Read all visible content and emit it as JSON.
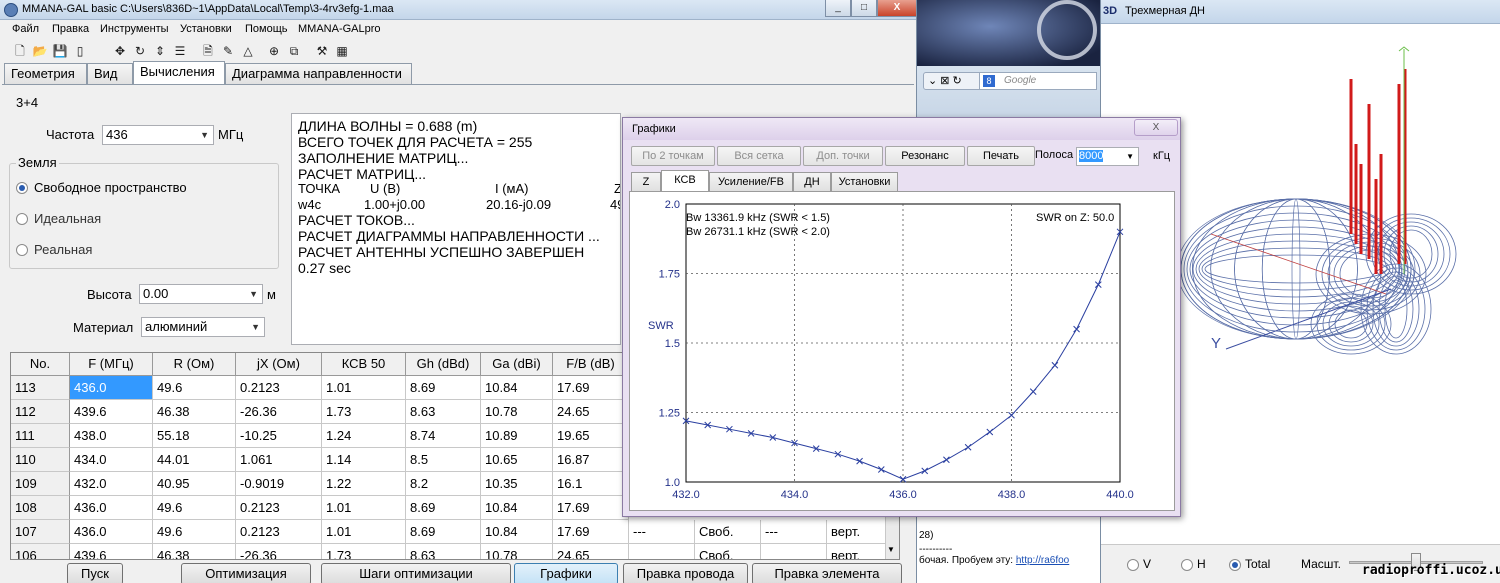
{
  "main_window": {
    "title": "MMANA-GAL basic C:\\Users\\836D~1\\AppData\\Local\\Temp\\3-4rv3efg-1.maa",
    "caption_buttons": [
      "_",
      "□",
      "X"
    ],
    "menu": [
      "Файл",
      "Правка",
      "Инструменты",
      "Установки",
      "Помощь",
      "MMANA-GALpro"
    ],
    "tabs": [
      "Геометрия",
      "Вид",
      "Вычисления",
      "Диаграмма направленности"
    ],
    "antenna_name": "3+4",
    "frequency": {
      "label": "Частота",
      "value": "436",
      "unit": "МГц"
    },
    "ground": {
      "label": "Земля",
      "options": [
        "Свободное пространство",
        "Идеальная",
        "Реальная"
      ],
      "selected": "Свободное пространство"
    },
    "height": {
      "label": "Высота",
      "value": "0.00",
      "unit": "м"
    },
    "material": {
      "label": "Материал",
      "value": "алюминий"
    },
    "log": [
      "ДЛИНА ВОЛНЫ = 0.688 (m)",
      "ВСЕГО ТОЧЕК ДЛЯ РАСЧЕТА = 255",
      "ЗАПОЛНЕНИЕ МАТРИЦ...",
      "РАСЧЕТ МАТРИЦ...",
      "РАСЧЕТ ТОКОВ...",
      "РАСЧЕТ ДИАГРАММЫ НАПРАВЛЕННОСТИ ...",
      "РАСЧЕТ АНТЕННЫ УСПЕШНО ЗАВЕРШЕН",
      "0.27 sec"
    ],
    "log_point_header": [
      "ТОЧКА",
      "U (В)",
      "I (мА)",
      "Z"
    ],
    "log_point_row": [
      "w4c",
      "1.00+j0.00",
      "20.16-j0.09",
      "49"
    ],
    "table": {
      "columns": [
        "No.",
        "F (МГц)",
        "R (Ом)",
        "jX (Ом)",
        "КСВ 50",
        "Gh (dBd)",
        "Ga (dBi)",
        "F/B (dB)"
      ],
      "rows": [
        [
          "113",
          "436.0",
          "49.6",
          "0.2123",
          "1.01",
          "8.69",
          "10.84",
          "17.69"
        ],
        [
          "112",
          "439.6",
          "46.38",
          "-26.36",
          "1.73",
          "8.63",
          "10.78",
          "24.65"
        ],
        [
          "111",
          "438.0",
          "55.18",
          "-10.25",
          "1.24",
          "8.74",
          "10.89",
          "19.65"
        ],
        [
          "110",
          "434.0",
          "44.01",
          "1.061",
          "1.14",
          "8.5",
          "10.65",
          "16.87"
        ],
        [
          "109",
          "432.0",
          "40.95",
          "-0.9019",
          "1.22",
          "8.2",
          "10.35",
          "16.1"
        ],
        [
          "108",
          "436.0",
          "49.6",
          "0.2123",
          "1.01",
          "8.69",
          "10.84",
          "17.69"
        ],
        [
          "107",
          "436.0",
          "49.6",
          "0.2123",
          "1.01",
          "8.69",
          "10.84",
          "17.69"
        ],
        [
          "106",
          "439.6",
          "46.38",
          "-26.36",
          "1.73",
          "8.63",
          "10.78",
          "24.65"
        ]
      ],
      "row107_extra": [
        "---",
        "Своб.",
        "---",
        "верт."
      ],
      "row106_extra": [
        "",
        "Своб.",
        "",
        "верт."
      ]
    },
    "bottom_buttons": [
      "Пуск",
      "Оптимизация",
      "Шаги оптимизации",
      "Графики",
      "Правка провода",
      "Правка элемента"
    ]
  },
  "background": {
    "search_placeholder": "Google",
    "text_fragment_1": "28)",
    "text_fragment_2": "бочая. Пробуем эту:",
    "link_fragment": "http://ra6foo"
  },
  "window_3d": {
    "badge": "3D",
    "title": "Трехмерная ДН",
    "axis_y": "Y",
    "view_options": [
      "V",
      "H",
      "Total"
    ],
    "view_selected": "Total",
    "scale_label": "Масшт.",
    "watermark": "radioproffi.ucoz.ua",
    "pattern_color": "#5a6fa8",
    "element_color": "#d11a1a"
  },
  "charts_dialog": {
    "title": "Графики",
    "close": "X",
    "buttons": [
      "По 2 точкам",
      "Вся сетка",
      "Доп. точки",
      "Резонанс",
      "Печать"
    ],
    "band": {
      "label": "Полоса",
      "value": "8000",
      "unit": "кГц"
    },
    "tabs": [
      "Z",
      "КСВ",
      "Усиление/FB",
      "ДН",
      "Установки"
    ],
    "active_tab": "КСВ",
    "info_lines": [
      "Bw 13361.9 kHz (SWR < 1.5)",
      "Bw 26731.1 kHz (SWR < 2.0)"
    ],
    "swr_on_z": "SWR on Z: 50.0"
  },
  "chart_data": {
    "type": "line",
    "title": "",
    "xlabel": "",
    "ylabel": "SWR",
    "xlim": [
      432.0,
      440.0
    ],
    "ylim": [
      1.0,
      2.0
    ],
    "x_ticks": [
      "432.0",
      "434.0",
      "436.0",
      "438.0",
      "440.0"
    ],
    "y_ticks": [
      "1.0",
      "1.25",
      "1.5",
      "1.75",
      "2.0"
    ],
    "grid": true,
    "series_color": "#2a3fa0",
    "series": [
      {
        "x": [
          432.0,
          432.4,
          432.8,
          433.2,
          433.6,
          434.0,
          434.4,
          434.8,
          435.2,
          435.6,
          436.0,
          436.4,
          436.8,
          437.2,
          437.6,
          438.0,
          438.4,
          438.8,
          439.2,
          439.6,
          440.0
        ],
        "y": [
          1.22,
          1.205,
          1.19,
          1.175,
          1.16,
          1.14,
          1.12,
          1.1,
          1.075,
          1.045,
          1.01,
          1.04,
          1.08,
          1.125,
          1.18,
          1.24,
          1.325,
          1.42,
          1.55,
          1.71,
          1.9
        ]
      }
    ]
  }
}
